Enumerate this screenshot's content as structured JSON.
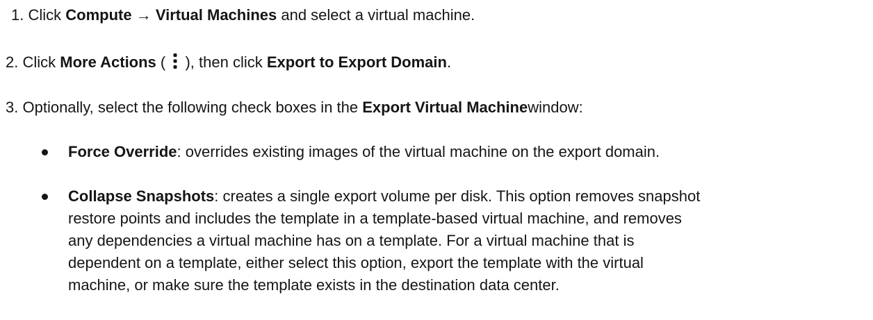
{
  "steps": [
    {
      "num": "1.",
      "pre": "Click ",
      "b1": "Compute → Virtual Machines",
      "post": " and select a virtual machine."
    },
    {
      "num": "2.",
      "pre": "Click ",
      "b1": "More Actions",
      "paren_open": " ( ",
      "icon": "kebab-icon",
      "paren_close": " ), then click ",
      "b2": "Export to Export Domain",
      "post": "."
    },
    {
      "num": "3.",
      "pre": "Optionally, select the following check boxes in the ",
      "b1": "Export Virtual Machine",
      "post": "window:"
    }
  ],
  "bullets": [
    {
      "term": "Force Override",
      "text": ": overrides existing images of the virtual machine on the export domain."
    },
    {
      "term": "Collapse Snapshots",
      "text_lines": [
        ": creates a single export volume per disk. This option removes snapshot",
        "restore points and includes the template in a template-based virtual machine, and removes",
        "any dependencies a virtual machine has on a template. For a virtual machine that is",
        "dependent on a template, either select this option, export the template with the virtual",
        "machine, or make sure the template exists in the destination data center."
      ]
    }
  ]
}
